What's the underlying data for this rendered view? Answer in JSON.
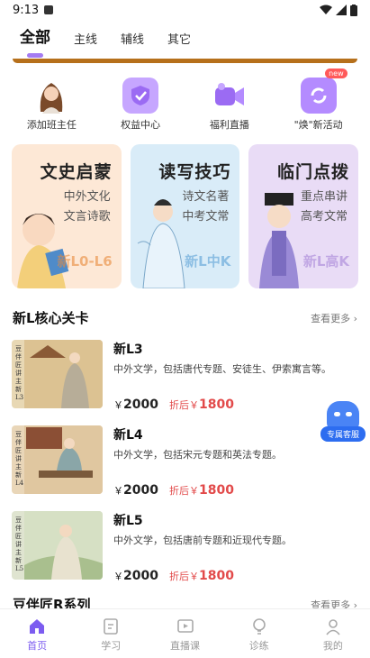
{
  "status": {
    "time": "9:13"
  },
  "tabs": [
    {
      "label": "全部"
    },
    {
      "label": "主线"
    },
    {
      "label": "辅线"
    },
    {
      "label": "其它"
    }
  ],
  "quick": [
    {
      "label": "添加班主任",
      "icon": "teacher-avatar-icon"
    },
    {
      "label": "权益中心",
      "icon": "shield-icon"
    },
    {
      "label": "福利直播",
      "icon": "camera-icon"
    },
    {
      "label": "\"焕\"新活动",
      "icon": "refresh-icon",
      "badge": "new"
    }
  ],
  "cards": [
    {
      "title": "文史启蒙",
      "sub1": "中外文化",
      "sub2": "文言诗歌",
      "tag": "新L0-L6",
      "bg": "#fde8d6",
      "tagColor": "#e98a3b"
    },
    {
      "title": "读写技巧",
      "sub1": "诗文名著",
      "sub2": "中考文常",
      "tag": "新L中K",
      "bg": "#d9ecf8",
      "tagColor": "#5aa0d6"
    },
    {
      "title": "临门点拨",
      "sub1": "重点串讲",
      "sub2": "高考文常",
      "tag": "新L高K",
      "bg": "#e9dcf6",
      "tagColor": "#a683d8"
    }
  ],
  "section1": {
    "title": "新L核心关卡",
    "more": "查看更多"
  },
  "courses": [
    {
      "name": "新L3",
      "desc": "中外文学，包括唐代专题、安徒生、伊索寓言等。",
      "currency": "￥",
      "price": "2000",
      "discount_label": "折后￥",
      "discount_price": "1800",
      "thumb_text": "豆伴匠讲主 新L3"
    },
    {
      "name": "新L4",
      "desc": "中外文学，包括宋元专题和英法专题。",
      "currency": "￥",
      "price": "2000",
      "discount_label": "折后￥",
      "discount_price": "1800",
      "thumb_text": "豆伴匠讲主 新L4"
    },
    {
      "name": "新L5",
      "desc": "中外文学，包括唐前专题和近现代专题。",
      "currency": "￥",
      "price": "2000",
      "discount_label": "折后￥",
      "discount_price": "1800",
      "thumb_text": "豆伴匠讲主 新L5"
    }
  ],
  "section2": {
    "title": "豆伴匠R系列",
    "more": "查看更多"
  },
  "service": {
    "label": "专属客服"
  },
  "nav": [
    {
      "label": "首页",
      "icon": "home-icon"
    },
    {
      "label": "学习",
      "icon": "book-icon"
    },
    {
      "label": "直播课",
      "icon": "live-icon"
    },
    {
      "label": "诊练",
      "icon": "bulb-icon"
    },
    {
      "label": "我的",
      "icon": "profile-icon"
    }
  ],
  "colors": {
    "accent": "#7c5cf0",
    "price_red": "#e24a4a",
    "banner": "#b6701b"
  }
}
